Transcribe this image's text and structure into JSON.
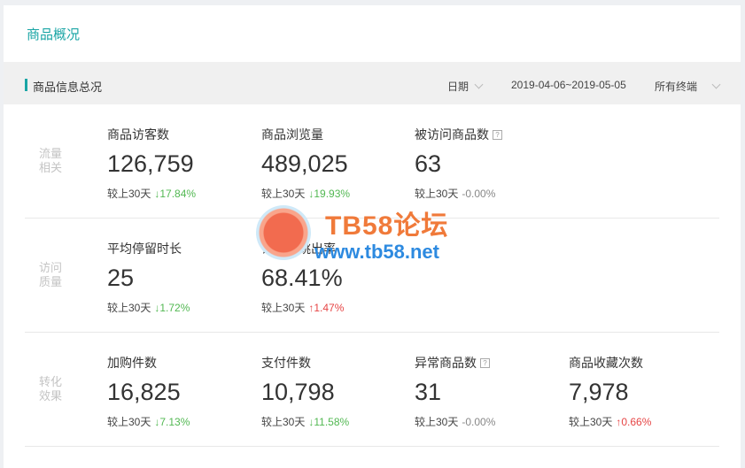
{
  "page": {
    "title": "商品概况"
  },
  "section": {
    "title": "商品信息总况",
    "filters": {
      "date_label": "日期",
      "date_range": "2019-04-06~2019-05-05",
      "terminal": "所有终端"
    }
  },
  "colors": {
    "accent": "#1aa5a5",
    "down": "#52b852",
    "up": "#e64545"
  },
  "rows": [
    {
      "label_line1": "流量",
      "label_line2": "相关",
      "metrics": [
        {
          "name": "商品访客数",
          "value": "126,759",
          "compare": "较上30天",
          "trend": "down",
          "arrow": "↓",
          "change": "17.84%"
        },
        {
          "name": "商品浏览量",
          "value": "489,025",
          "compare": "较上30天",
          "trend": "down",
          "arrow": "↓",
          "change": "19.93%"
        },
        {
          "name": "被访问商品数",
          "help": "?",
          "value": "63",
          "compare": "较上30天",
          "trend": "flat",
          "arrow": "-",
          "change": "0.00%"
        }
      ]
    },
    {
      "label_line1": "访问",
      "label_line2": "质量",
      "metrics": [
        {
          "name": "平均停留时长",
          "value": "25",
          "compare": "较上30天",
          "trend": "down",
          "arrow": "↓",
          "change": "1.72%"
        },
        {
          "name": "详情页跳出率",
          "value": "68.41%",
          "compare": "较上30天",
          "trend": "up",
          "arrow": "↑",
          "change": "1.47%"
        }
      ]
    },
    {
      "label_line1": "转化",
      "label_line2": "效果",
      "metrics": [
        {
          "name": "加购件数",
          "value": "16,825",
          "compare": "较上30天",
          "trend": "down",
          "arrow": "↓",
          "change": "7.13%"
        },
        {
          "name": "支付件数",
          "value": "10,798",
          "compare": "较上30天",
          "trend": "down",
          "arrow": "↓",
          "change": "11.58%"
        },
        {
          "name": "异常商品数",
          "help": "?",
          "value": "31",
          "compare": "较上30天",
          "trend": "flat",
          "arrow": "-",
          "change": "0.00%"
        },
        {
          "name": "商品收藏次数",
          "value": "7,978",
          "compare": "较上30天",
          "trend": "up",
          "arrow": "↑",
          "change": "0.66%"
        }
      ]
    }
  ],
  "watermark": {
    "main": "TB58论坛",
    "url": "www.tb58.net"
  }
}
